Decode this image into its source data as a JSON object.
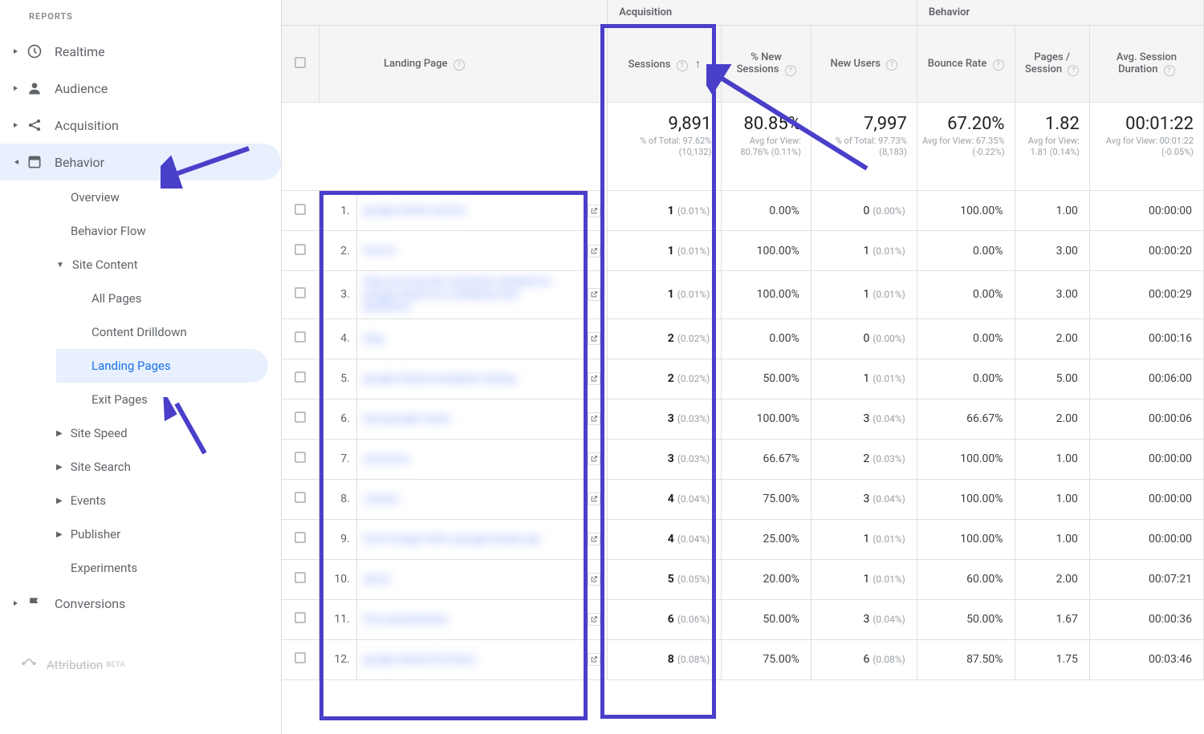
{
  "sidebar": {
    "header": "REPORTS",
    "top_items": [
      {
        "id": "realtime",
        "label": "Realtime",
        "icon": "clock"
      },
      {
        "id": "audience",
        "label": "Audience",
        "icon": "person"
      },
      {
        "id": "acquisition",
        "label": "Acquisition",
        "icon": "share"
      },
      {
        "id": "behavior",
        "label": "Behavior",
        "icon": "page",
        "expanded": true
      }
    ],
    "behavior_sub": [
      {
        "id": "overview",
        "label": "Overview"
      },
      {
        "id": "bflow",
        "label": "Behavior Flow"
      },
      {
        "id": "sitecontent",
        "label": "Site Content",
        "expanded": true,
        "children": [
          {
            "id": "allpages",
            "label": "All Pages"
          },
          {
            "id": "drilldown",
            "label": "Content Drilldown"
          },
          {
            "id": "landing",
            "label": "Landing Pages",
            "selected": true
          },
          {
            "id": "exit",
            "label": "Exit Pages"
          }
        ]
      },
      {
        "id": "sitespeed",
        "label": "Site Speed",
        "caret": true
      },
      {
        "id": "sitesearch",
        "label": "Site Search",
        "caret": true
      },
      {
        "id": "events",
        "label": "Events",
        "caret": true
      },
      {
        "id": "publisher",
        "label": "Publisher",
        "caret": true
      },
      {
        "id": "experiments",
        "label": "Experiments"
      }
    ],
    "conversions": {
      "label": "Conversions"
    },
    "attribution": {
      "label": "Attribution",
      "beta": "BETA"
    }
  },
  "table": {
    "group_headers": {
      "acquisition": "Acquisition",
      "behavior": "Behavior"
    },
    "columns": {
      "landing_page": "Landing Page",
      "sessions": "Sessions",
      "pct_new": "% New Sessions",
      "new_users": "New Users",
      "bounce": "Bounce Rate",
      "pps": "Pages / Session",
      "duration": "Avg. Session Duration"
    },
    "summary": {
      "sessions": {
        "main": "9,891",
        "sub": "% of Total: 97.62% (10,132)"
      },
      "pct_new": {
        "main": "80.85%",
        "sub": "Avg for View: 80.76% (0.11%)"
      },
      "new_users": {
        "main": "7,997",
        "sub": "% of Total: 97.73% (8,183)"
      },
      "bounce": {
        "main": "67.20%",
        "sub": "Avg for View: 67.35% (-0.22%)"
      },
      "pps": {
        "main": "1.82",
        "sub": "Avg for View: 1.81 (0.14%)"
      },
      "duration": {
        "main": "00:01:22",
        "sub": "Avg for View: 00:01:22 (-0.05%)"
      }
    },
    "rows": [
      {
        "idx": "1.",
        "page": "google-sheets-tutorial",
        "sessions": "1",
        "sessions_pct": "(0.01%)",
        "pct_new": "0.00%",
        "new_users": "0",
        "new_users_pct": "(0.00%)",
        "bounce": "100.00%",
        "pps": "1.00",
        "duration": "00:00:00"
      },
      {
        "idx": "2.",
        "page": "how-to",
        "sessions": "1",
        "sessions_pct": "(0.01%)",
        "pct_new": "100.00%",
        "new_users": "1",
        "new_users_pct": "(0.01%)",
        "bounce": "0.00%",
        "pps": "3.00",
        "duration": "00:00:20"
      },
      {
        "idx": "3.",
        "page": "help-and-tutorials-standards-adopted-for-google-sheets-as-a-database-and-guidelines",
        "sessions": "1",
        "sessions_pct": "(0.01%)",
        "pct_new": "100.00%",
        "new_users": "1",
        "new_users_pct": "(0.01%)",
        "bounce": "0.00%",
        "pps": "3.00",
        "duration": "00:00:29"
      },
      {
        "idx": "4.",
        "page": "blog",
        "sessions": "2",
        "sessions_pct": "(0.02%)",
        "pct_new": "0.00%",
        "new_users": "0",
        "new_users_pct": "(0.00%)",
        "bounce": "0.00%",
        "pps": "2.00",
        "duration": "00:00:16"
      },
      {
        "idx": "5.",
        "page": "google-sheets-templates-catalog",
        "sessions": "2",
        "sessions_pct": "(0.02%)",
        "pct_new": "50.00%",
        "new_users": "1",
        "new_users_pct": "(0.01%)",
        "bounce": "0.00%",
        "pps": "5.00",
        "duration": "00:06:00"
      },
      {
        "idx": "6.",
        "page": "best-google-charts",
        "sessions": "3",
        "sessions_pct": "(0.03%)",
        "pct_new": "100.00%",
        "new_users": "3",
        "new_users_pct": "(0.04%)",
        "bounce": "66.67%",
        "pps": "2.00",
        "duration": "00:00:06"
      },
      {
        "idx": "7.",
        "page": "resources",
        "sessions": "3",
        "sessions_pct": "(0.03%)",
        "pct_new": "66.67%",
        "new_users": "2",
        "new_users_pct": "(0.03%)",
        "bounce": "100.00%",
        "pps": "1.00",
        "duration": "00:00:00"
      },
      {
        "idx": "8.",
        "page": "contact",
        "sessions": "4",
        "sessions_pct": "(0.04%)",
        "pct_new": "75.00%",
        "new_users": "3",
        "new_users_pct": "(0.04%)",
        "bounce": "100.00%",
        "pps": "1.00",
        "duration": "00:00:00"
      },
      {
        "idx": "9.",
        "page": "how-to-begin-with-a-google-sheets-api",
        "sessions": "4",
        "sessions_pct": "(0.04%)",
        "pct_new": "25.00%",
        "new_users": "1",
        "new_users_pct": "(0.01%)",
        "bounce": "100.00%",
        "pps": "1.00",
        "duration": "00:00:00"
      },
      {
        "idx": "10.",
        "page": "about",
        "sessions": "5",
        "sessions_pct": "(0.05%)",
        "pct_new": "20.00%",
        "new_users": "1",
        "new_users_pct": "(0.01%)",
        "bounce": "60.00%",
        "pps": "2.00",
        "duration": "00:07:21"
      },
      {
        "idx": "11.",
        "page": "free-spreadsheets",
        "sessions": "6",
        "sessions_pct": "(0.06%)",
        "pct_new": "50.00%",
        "new_users": "3",
        "new_users_pct": "(0.04%)",
        "bounce": "50.00%",
        "pps": "1.67",
        "duration": "00:00:36"
      },
      {
        "idx": "12.",
        "page": "google-sheets-functions",
        "sessions": "8",
        "sessions_pct": "(0.08%)",
        "pct_new": "75.00%",
        "new_users": "6",
        "new_users_pct": "(0.08%)",
        "bounce": "87.50%",
        "pps": "1.75",
        "duration": "00:03:46"
      }
    ]
  }
}
